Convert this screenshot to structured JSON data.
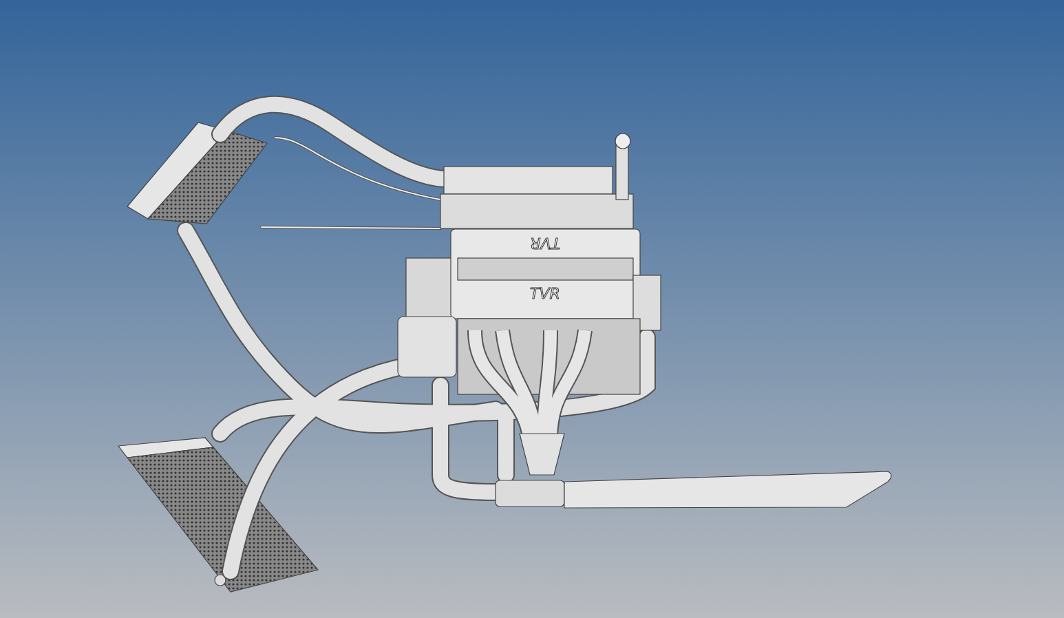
{
  "viewport": {
    "model_logos": [
      {
        "text": "TVR",
        "flipped": true
      },
      {
        "text": "TVR",
        "flipped": false
      }
    ]
  }
}
